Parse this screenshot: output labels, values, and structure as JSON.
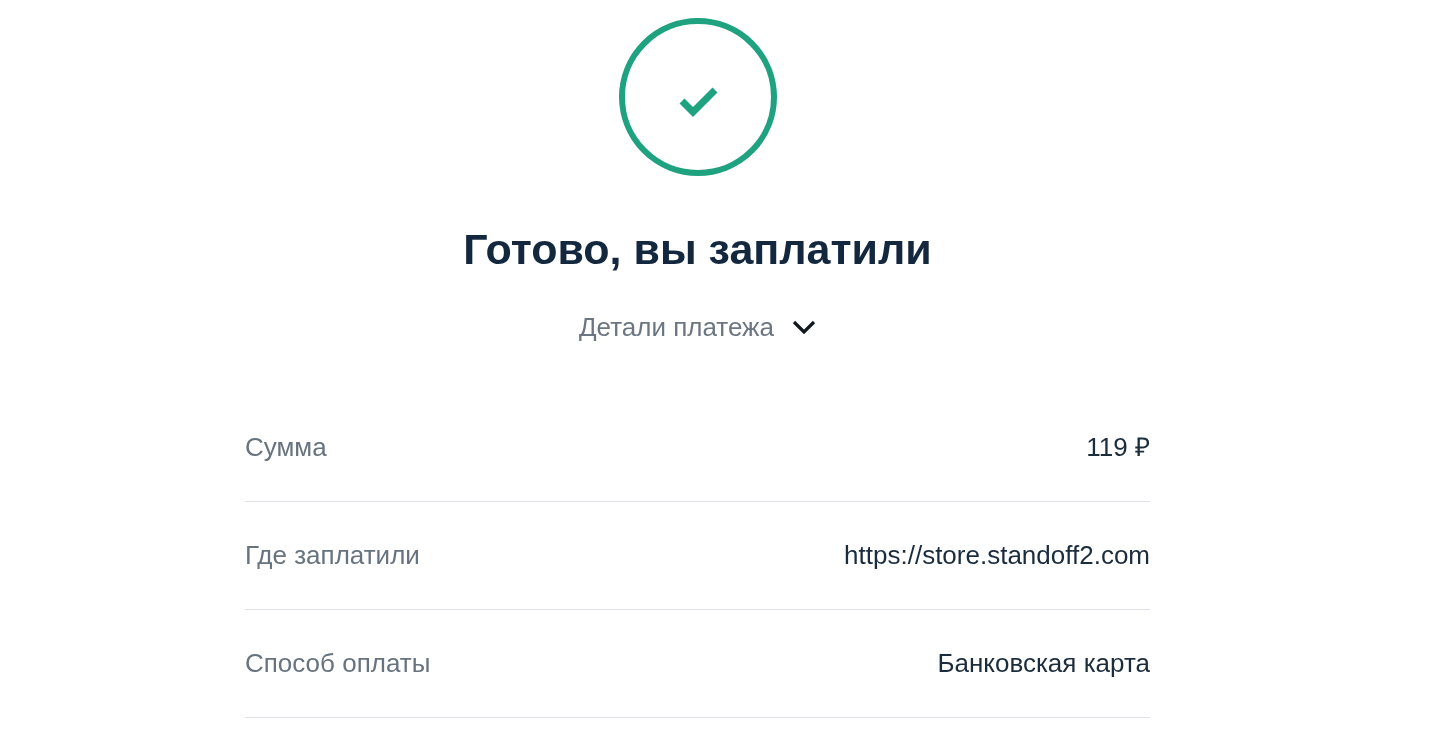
{
  "status": {
    "kind": "success"
  },
  "title": "Готово, вы заплатили",
  "details_toggle": {
    "label": "Детали платежа",
    "expanded": true
  },
  "details": [
    {
      "label": "Сумма",
      "value": "119 ₽"
    },
    {
      "label": "Где заплатили",
      "value": "https://store.standoff2.com"
    },
    {
      "label": "Способ оплаты",
      "value": "Банковская карта"
    }
  ]
}
